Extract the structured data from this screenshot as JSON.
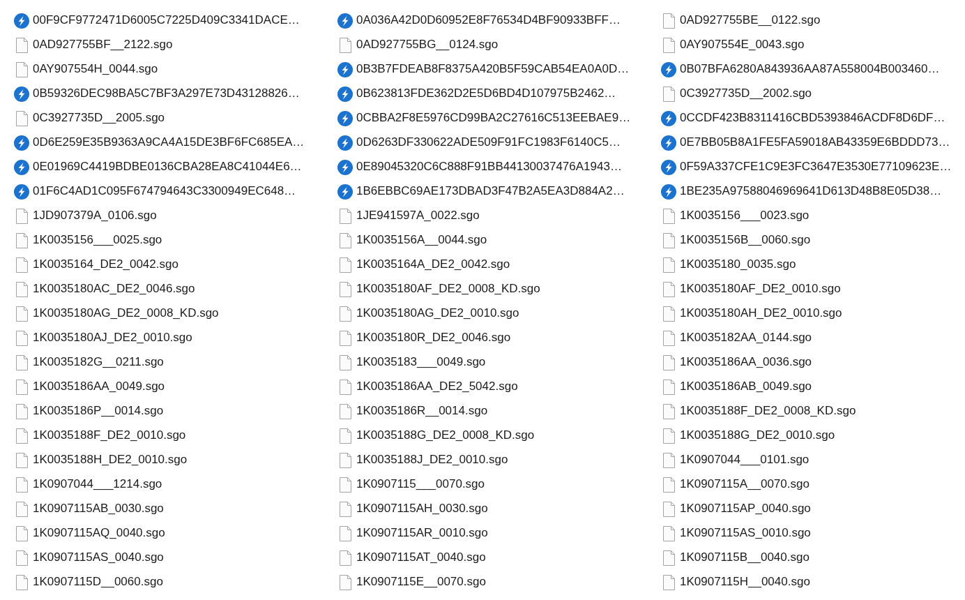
{
  "files": [
    {
      "kind": "shortcut",
      "name": "00F9CF9772471D6005C7225D409C3341DACE…"
    },
    {
      "kind": "shortcut",
      "name": "0A036A42D0D60952E8F76534D4BF90933BFF…"
    },
    {
      "kind": "file",
      "name": "0AD927755BE__0122.sgo"
    },
    {
      "kind": "file",
      "name": "0AD927755BF__2122.sgo"
    },
    {
      "kind": "file",
      "name": "0AD927755BG__0124.sgo"
    },
    {
      "kind": "file",
      "name": "0AY907554E_0043.sgo"
    },
    {
      "kind": "file",
      "name": "0AY907554H_0044.sgo"
    },
    {
      "kind": "shortcut",
      "name": "0B3B7FDEAB8F8375A420B5F59CAB54EA0A0D…"
    },
    {
      "kind": "shortcut",
      "name": "0B07BFA6280A843936AA87A558004B003460…"
    },
    {
      "kind": "shortcut",
      "name": "0B59326DEC98BA5C7BF3A297E73D43128826…"
    },
    {
      "kind": "shortcut",
      "name": "0B623813FDE362D2E5D6BD4D107975B2462…"
    },
    {
      "kind": "file",
      "name": "0C3927735D__2002.sgo"
    },
    {
      "kind": "file",
      "name": "0C3927735D__2005.sgo"
    },
    {
      "kind": "shortcut",
      "name": "0CBBA2F8E5976CD99BA2C27616C513EEBAE9…"
    },
    {
      "kind": "shortcut",
      "name": "0CCDF423B8311416CBD5393846ACDF8D6DF…"
    },
    {
      "kind": "shortcut",
      "name": "0D6E259E35B9363A9CA4A15DE3BF6FC685EA…"
    },
    {
      "kind": "shortcut",
      "name": "0D6263DF330622ADE509F91FC1983F6140C5…"
    },
    {
      "kind": "shortcut",
      "name": "0E7BB05B8A1FE5FA59018AB43359E6BDDD73…"
    },
    {
      "kind": "shortcut",
      "name": "0E01969C4419BDBE0136CBA28EA8C41044E6…"
    },
    {
      "kind": "shortcut",
      "name": "0E89045320C6C888F91BB44130037476A1943…"
    },
    {
      "kind": "shortcut",
      "name": "0F59A337CFE1C9E3FC3647E3530E77109623E…"
    },
    {
      "kind": "shortcut",
      "name": "01F6C4AD1C095F674794643C3300949EC648…"
    },
    {
      "kind": "shortcut",
      "name": "1B6EBBC69AE173DBAD3F47B2A5EA3D884A2…"
    },
    {
      "kind": "shortcut",
      "name": "1BE235A97588046969641D613D48B8E05D38…"
    },
    {
      "kind": "file",
      "name": "1JD907379A_0106.sgo"
    },
    {
      "kind": "file",
      "name": "1JE941597A_0022.sgo"
    },
    {
      "kind": "file",
      "name": "1K0035156___0023.sgo"
    },
    {
      "kind": "file",
      "name": "1K0035156___0025.sgo"
    },
    {
      "kind": "file",
      "name": "1K0035156A__0044.sgo"
    },
    {
      "kind": "file",
      "name": "1K0035156B__0060.sgo"
    },
    {
      "kind": "file",
      "name": "1K0035164_DE2_0042.sgo"
    },
    {
      "kind": "file",
      "name": "1K0035164A_DE2_0042.sgo"
    },
    {
      "kind": "file",
      "name": "1K0035180_0035.sgo"
    },
    {
      "kind": "file",
      "name": "1K0035180AC_DE2_0046.sgo"
    },
    {
      "kind": "file",
      "name": "1K0035180AF_DE2_0008_KD.sgo"
    },
    {
      "kind": "file",
      "name": "1K0035180AF_DE2_0010.sgo"
    },
    {
      "kind": "file",
      "name": "1K0035180AG_DE2_0008_KD.sgo"
    },
    {
      "kind": "file",
      "name": "1K0035180AG_DE2_0010.sgo"
    },
    {
      "kind": "file",
      "name": "1K0035180AH_DE2_0010.sgo"
    },
    {
      "kind": "file",
      "name": "1K0035180AJ_DE2_0010.sgo"
    },
    {
      "kind": "file",
      "name": "1K0035180R_DE2_0046.sgo"
    },
    {
      "kind": "file",
      "name": "1K0035182AA_0144.sgo"
    },
    {
      "kind": "file",
      "name": "1K0035182G__0211.sgo"
    },
    {
      "kind": "file",
      "name": "1K0035183___0049.sgo"
    },
    {
      "kind": "file",
      "name": "1K0035186AA_0036.sgo"
    },
    {
      "kind": "file",
      "name": "1K0035186AA_0049.sgo"
    },
    {
      "kind": "file",
      "name": "1K0035186AA_DE2_5042.sgo"
    },
    {
      "kind": "file",
      "name": "1K0035186AB_0049.sgo"
    },
    {
      "kind": "file",
      "name": "1K0035186P__0014.sgo"
    },
    {
      "kind": "file",
      "name": "1K0035186R__0014.sgo"
    },
    {
      "kind": "file",
      "name": "1K0035188F_DE2_0008_KD.sgo"
    },
    {
      "kind": "file",
      "name": "1K0035188F_DE2_0010.sgo"
    },
    {
      "kind": "file",
      "name": "1K0035188G_DE2_0008_KD.sgo"
    },
    {
      "kind": "file",
      "name": "1K0035188G_DE2_0010.sgo"
    },
    {
      "kind": "file",
      "name": "1K0035188H_DE2_0010.sgo"
    },
    {
      "kind": "file",
      "name": "1K0035188J_DE2_0010.sgo"
    },
    {
      "kind": "file",
      "name": "1K0907044___0101.sgo"
    },
    {
      "kind": "file",
      "name": "1K0907044___1214.sgo"
    },
    {
      "kind": "file",
      "name": "1K0907115___0070.sgo"
    },
    {
      "kind": "file",
      "name": "1K0907115A__0070.sgo"
    },
    {
      "kind": "file",
      "name": "1K0907115AB_0030.sgo"
    },
    {
      "kind": "file",
      "name": "1K0907115AH_0030.sgo"
    },
    {
      "kind": "file",
      "name": "1K0907115AP_0040.sgo"
    },
    {
      "kind": "file",
      "name": "1K0907115AQ_0040.sgo"
    },
    {
      "kind": "file",
      "name": "1K0907115AR_0010.sgo"
    },
    {
      "kind": "file",
      "name": "1K0907115AS_0010.sgo"
    },
    {
      "kind": "file",
      "name": "1K0907115AS_0040.sgo"
    },
    {
      "kind": "file",
      "name": "1K0907115AT_0040.sgo"
    },
    {
      "kind": "file",
      "name": "1K0907115B__0040.sgo"
    },
    {
      "kind": "file",
      "name": "1K0907115D__0060.sgo"
    },
    {
      "kind": "file",
      "name": "1K0907115E__0070.sgo"
    },
    {
      "kind": "file",
      "name": "1K0907115H__0040.sgo"
    }
  ]
}
